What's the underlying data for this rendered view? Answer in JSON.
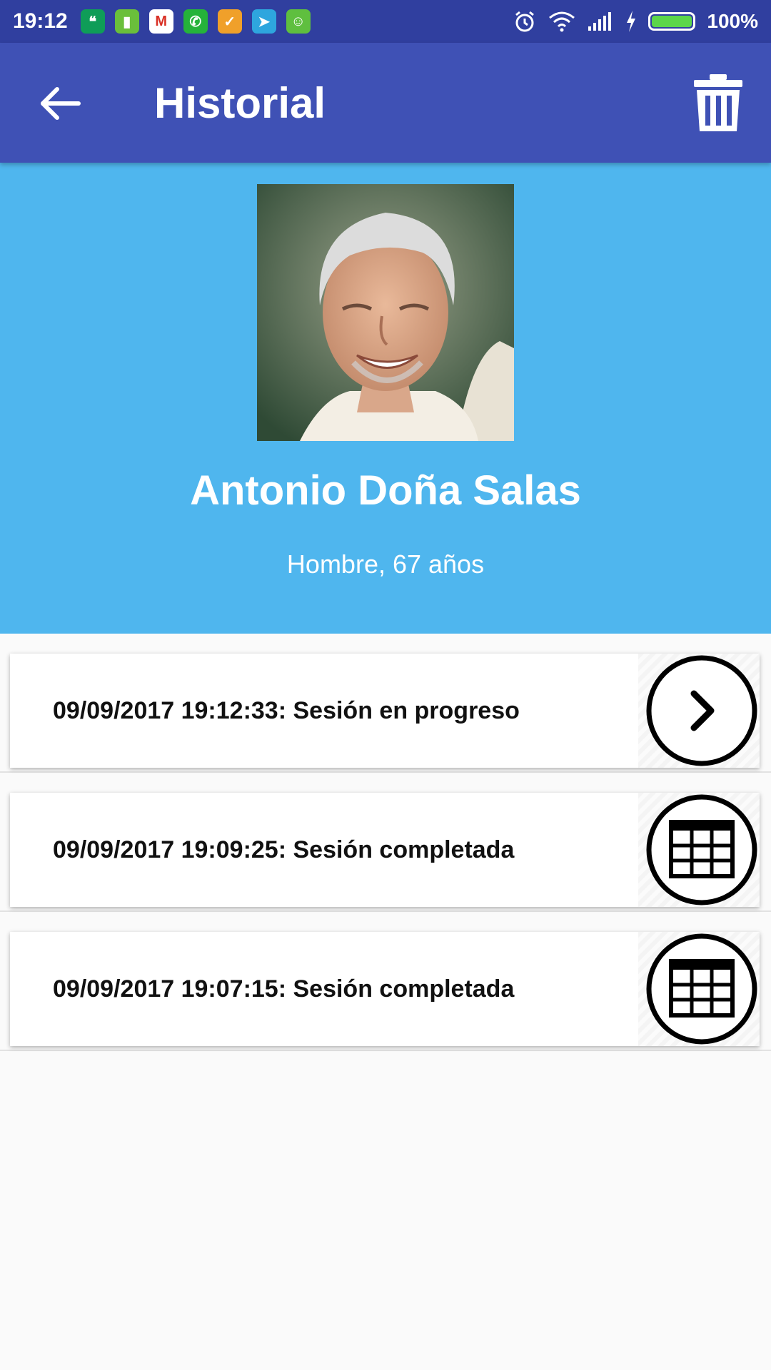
{
  "status_bar": {
    "time": "19:12",
    "battery_percent_label": "100%",
    "battery_level": 1.0,
    "apps": [
      {
        "icon": "hangouts-icon",
        "color": "#0f9d58",
        "glyph": "❝"
      },
      {
        "icon": "battery-app-icon",
        "color": "#6abf3b",
        "glyph": "▮"
      },
      {
        "icon": "gmail-icon",
        "color": "#ffffff",
        "glyph": "M"
      },
      {
        "icon": "whatsapp-icon",
        "color": "#25b33a",
        "glyph": "✆"
      },
      {
        "icon": "orange-app-icon",
        "color": "#f0a02a",
        "glyph": "✓"
      },
      {
        "icon": "telegram-icon",
        "color": "#2ea6de",
        "glyph": "➤"
      },
      {
        "icon": "android-app-icon",
        "color": "#5fbf3f",
        "glyph": "☺"
      }
    ]
  },
  "appbar": {
    "title": "Historial",
    "back_icon": "arrow-back-icon",
    "delete_icon": "trash-icon"
  },
  "profile": {
    "name": "Antonio Doña Salas",
    "subtitle": "Hombre, 67 años"
  },
  "sessions": [
    {
      "label": "09/09/2017 19:12:33: Sesión en progreso",
      "icon": "chevron-right-circle-icon"
    },
    {
      "label": "09/09/2017 19:09:25: Sesión completada",
      "icon": "table-circle-icon"
    },
    {
      "label": "09/09/2017 19:07:15: Sesión completada",
      "icon": "table-circle-icon"
    }
  ],
  "colors": {
    "status_bar": "#303f9f",
    "app_bar": "#3f51b5",
    "header": "#4fb6ee",
    "background": "#fafafa"
  }
}
